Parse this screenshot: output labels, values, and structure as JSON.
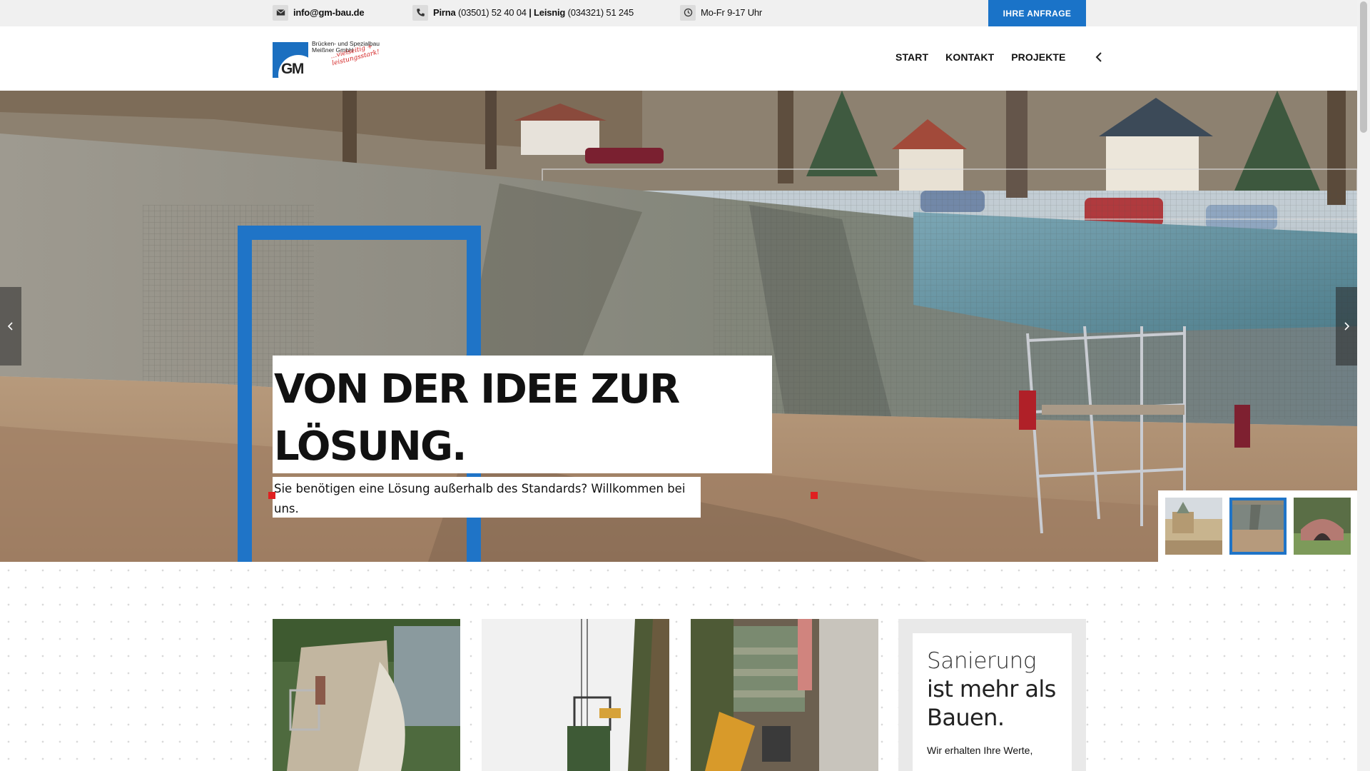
{
  "topbar": {
    "email": "info@gm-bau.de",
    "phone_city1": "Pirna",
    "phone_num1": "(03501) 52 40 04",
    "phone_sep": "|",
    "phone_city2": "Leisnig",
    "phone_num2": "(034321) 51 245",
    "hours": "Mo-Fr 9-17 Uhr",
    "cta_label": "IHRE ANFRAGE"
  },
  "logo": {
    "mark_text": "GM",
    "company_line1": "Brücken- und Spezialbau",
    "company_line2": "Meißner GmbH",
    "slogan_line1": "…vielseitig +",
    "slogan_line2": "leistungsstark!"
  },
  "nav": {
    "items": [
      "START",
      "KONTAKT",
      "PROJEKTE"
    ]
  },
  "hero": {
    "title_line1": "VON DER IDEE ZUR",
    "title_line2": "LÖSUNG.",
    "subtitle": "Sie benötigen eine Lösung außerhalb des Standards? Willkommen bei uns."
  },
  "info": {
    "heading_light": "Sanierung",
    "heading_bold_line1": "ist mehr als",
    "heading_bold_line2": "Bauen.",
    "text": "Wir erhalten Ihre Werte,"
  },
  "colors": {
    "accent_blue": "#1a73c8",
    "marker_red": "#e02020",
    "topbar_bg": "#f0f0f0"
  },
  "icons": {
    "email": "envelope-icon",
    "phone": "phone-icon",
    "hours": "clock-icon",
    "nav_back": "chevron-left-icon",
    "slider_prev": "chevron-left-icon",
    "slider_next": "chevron-right-icon"
  }
}
